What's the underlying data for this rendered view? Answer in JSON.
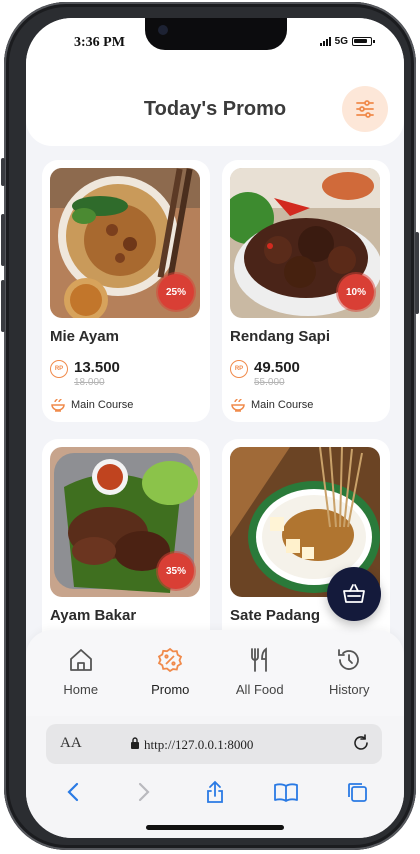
{
  "status_bar": {
    "time": "3:36 PM",
    "network": "5G"
  },
  "header": {
    "title": "Today's Promo",
    "filter_icon": "sliders-icon"
  },
  "currency_icon_label": "RP",
  "products": [
    {
      "name": "Mie Ayam",
      "price": "13.500",
      "old_price": "18.000",
      "discount": "25%",
      "category": "Main Course"
    },
    {
      "name": "Rendang Sapi",
      "price": "49.500",
      "old_price": "55.000",
      "discount": "10%",
      "category": "Main Course"
    },
    {
      "name": "Ayam Bakar",
      "price": "",
      "old_price": "",
      "discount": "35%",
      "category": ""
    },
    {
      "name": "Sate Padang",
      "price": "",
      "old_price": "",
      "discount": "",
      "category": ""
    }
  ],
  "cart_icon": "basket-icon",
  "bottom_nav": [
    {
      "label": "Home",
      "icon": "home-icon",
      "active": false
    },
    {
      "label": "Promo",
      "icon": "promo-badge-icon",
      "active": true
    },
    {
      "label": "All Food",
      "icon": "utensils-icon",
      "active": false
    },
    {
      "label": "History",
      "icon": "history-icon",
      "active": false
    }
  ],
  "browser": {
    "aa_label": "AA",
    "url": "http://127.0.0.1:8000"
  },
  "colors": {
    "accent": "#f08a4b",
    "discount_badge": "#d93f35",
    "basket_button": "#141a3b",
    "background": "#f3f4f8"
  }
}
